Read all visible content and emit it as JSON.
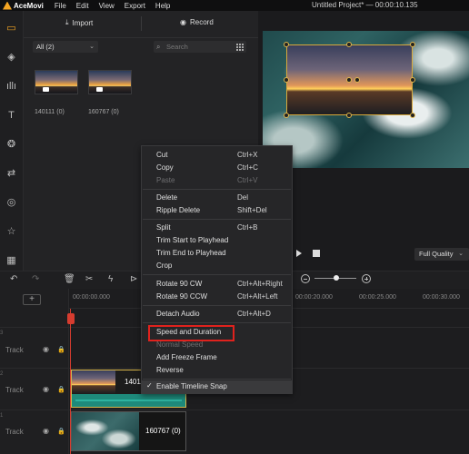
{
  "app": {
    "name": "AceMovi",
    "menus": [
      "File",
      "Edit",
      "View",
      "Export",
      "Help"
    ],
    "project_title": "Untitled Project* — 00:00:10.135"
  },
  "media_panel": {
    "import_label": "Import",
    "record_label": "Record",
    "filter_value": "All (2)",
    "search_placeholder": "Search",
    "items": [
      {
        "label": "140111 (0)"
      },
      {
        "label": "160767 (0)"
      }
    ]
  },
  "preview": {
    "quality": "Full Quality"
  },
  "timeline": {
    "ruler": [
      "00:00:00.000",
      "00:00:20.000",
      "00:00:25.000",
      "00:00:30.000"
    ],
    "tracks": [
      {
        "num": "3",
        "label": "Track"
      },
      {
        "num": "2",
        "label": "Track"
      },
      {
        "num": "1",
        "label": "Track"
      }
    ],
    "clips": [
      {
        "label": "140111"
      },
      {
        "label": "160767 (0)"
      }
    ]
  },
  "context_menu": {
    "items": [
      {
        "label": "Cut",
        "shortcut": "Ctrl+X"
      },
      {
        "label": "Copy",
        "shortcut": "Ctrl+C"
      },
      {
        "label": "Paste",
        "shortcut": "Ctrl+V"
      },
      {
        "label": "Delete",
        "shortcut": "Del"
      },
      {
        "label": "Ripple Delete",
        "shortcut": "Shift+Del"
      },
      {
        "label": "Split",
        "shortcut": "Ctrl+B"
      },
      {
        "label": "Trim Start to Playhead",
        "shortcut": ""
      },
      {
        "label": "Trim End to Playhead",
        "shortcut": ""
      },
      {
        "label": "Crop",
        "shortcut": ""
      },
      {
        "label": "Rotate 90 CW",
        "shortcut": "Ctrl+Alt+Right"
      },
      {
        "label": "Rotate 90 CCW",
        "shortcut": "Ctrl+Alt+Left"
      },
      {
        "label": "Detach Audio",
        "shortcut": "Ctrl+Alt+D"
      },
      {
        "label": "Speed and Duration",
        "shortcut": ""
      },
      {
        "label": "Normal Speed",
        "shortcut": ""
      },
      {
        "label": "Add Freeze Frame",
        "shortcut": ""
      },
      {
        "label": "Reverse",
        "shortcut": ""
      },
      {
        "label": "Enable Timeline Snap",
        "shortcut": ""
      }
    ]
  },
  "colors": {
    "accent": "#f5a623",
    "highlight_box": "#e0221d",
    "playhead": "#d63c2f"
  }
}
